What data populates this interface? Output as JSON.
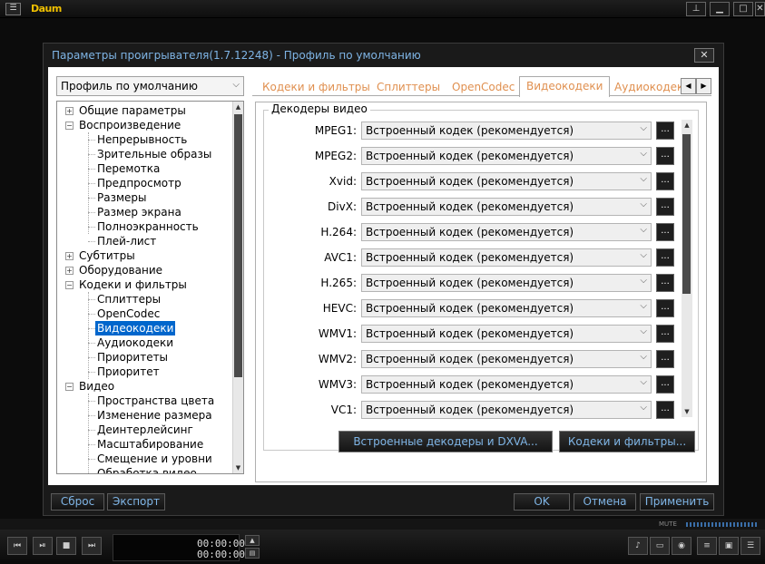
{
  "window": {
    "logo": "Daum",
    "menu_icon": "menu-icon",
    "controls": [
      "pin-icon",
      "minimize-icon",
      "maximize-icon",
      "close-icon"
    ]
  },
  "dialog": {
    "title": "Параметры проигрывателя(1.7.12248) - Профиль по умолчанию",
    "close": "✕",
    "profile": "Профиль по умолчанию",
    "tree": [
      {
        "label": "Общие параметры",
        "level": 0,
        "exp": "+"
      },
      {
        "label": "Воспроизведение",
        "level": 0,
        "exp": "−"
      },
      {
        "label": "Непрерывность",
        "level": 1
      },
      {
        "label": "Зрительные образы",
        "level": 1
      },
      {
        "label": "Перемотка",
        "level": 1
      },
      {
        "label": "Предпросмотр",
        "level": 1
      },
      {
        "label": "Размеры",
        "level": 1
      },
      {
        "label": "Размер экрана",
        "level": 1
      },
      {
        "label": "Полноэкранность",
        "level": 1
      },
      {
        "label": "Плей-лист",
        "level": 1
      },
      {
        "label": "Субтитры",
        "level": 0,
        "exp": "+"
      },
      {
        "label": "Оборудование",
        "level": 0,
        "exp": "+"
      },
      {
        "label": "Кодеки и фильтры",
        "level": 0,
        "exp": "−"
      },
      {
        "label": "Сплиттеры",
        "level": 1
      },
      {
        "label": "OpenCodec",
        "level": 1
      },
      {
        "label": "Видеокодеки",
        "level": 1,
        "selected": true
      },
      {
        "label": "Аудиокодеки",
        "level": 1
      },
      {
        "label": "Приоритеты",
        "level": 1
      },
      {
        "label": "Приоритет",
        "level": 1
      },
      {
        "label": "Видео",
        "level": 0,
        "exp": "−"
      },
      {
        "label": "Пространства цвета",
        "level": 1
      },
      {
        "label": "Изменение размера",
        "level": 1
      },
      {
        "label": "Деинтерлейсинг",
        "level": 1
      },
      {
        "label": "Масштабирование",
        "level": 1
      },
      {
        "label": "Смещение и уровни",
        "level": 1
      },
      {
        "label": "Обработка видео",
        "level": 1
      }
    ],
    "tabs": [
      {
        "label": "Кодеки и фильтры"
      },
      {
        "label": "Сплиттеры"
      },
      {
        "label": "OpenCodec"
      },
      {
        "label": "Видеокодеки",
        "active": true
      },
      {
        "label": "Аудиокодек"
      }
    ],
    "group_title": "Декодеры видео",
    "decoders": [
      {
        "label": "MPEG1:",
        "value": "Встроенный кодек (рекомендуется)"
      },
      {
        "label": "MPEG2:",
        "value": "Встроенный кодек (рекомендуется)"
      },
      {
        "label": "Xvid:",
        "value": "Встроенный кодек (рекомендуется)"
      },
      {
        "label": "DivX:",
        "value": "Встроенный кодек (рекомендуется)"
      },
      {
        "label": "H.264:",
        "value": "Встроенный кодек (рекомендуется)"
      },
      {
        "label": "AVC1:",
        "value": "Встроенный кодек (рекомендуется)"
      },
      {
        "label": "H.265:",
        "value": "Встроенный кодек (рекомендуется)"
      },
      {
        "label": "HEVC:",
        "value": "Встроенный кодек (рекомендуется)"
      },
      {
        "label": "WMV1:",
        "value": "Встроенный кодек (рекомендуется)"
      },
      {
        "label": "WMV2:",
        "value": "Встроенный кодек (рекомендуется)"
      },
      {
        "label": "WMV3:",
        "value": "Встроенный кодек (рекомендуется)"
      },
      {
        "label": "VC1:",
        "value": "Встроенный кодек (рекомендуется)"
      }
    ],
    "dots_label": "...",
    "builtin_button": "Встроенные декодеры и DXVA...",
    "codecs_button": "Кодеки и фильтры...",
    "footer": {
      "reset": "Сброс",
      "export": "Экспорт",
      "ok": "OK",
      "cancel": "Отмена",
      "apply": "Применить"
    }
  },
  "player": {
    "mute": "MUTE",
    "time_current": "00:00:00",
    "time_total": "00:00:00"
  }
}
